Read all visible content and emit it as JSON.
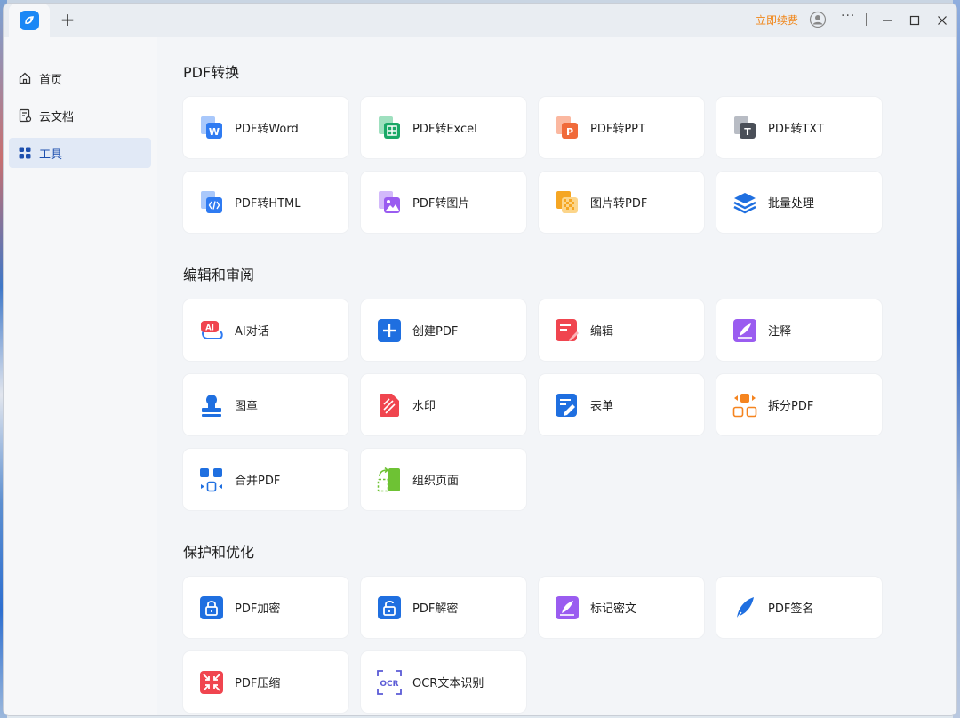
{
  "titlebar": {
    "new_tab": "+",
    "renew_label": "立即续费",
    "more": "···"
  },
  "sidebar": {
    "items": [
      {
        "label": "首页"
      },
      {
        "label": "云文档"
      },
      {
        "label": "工具"
      }
    ]
  },
  "sections": [
    {
      "title": "PDF转换",
      "tools": [
        {
          "label": "PDF转Word",
          "icon": "word-icon",
          "color": "#2f7bf2"
        },
        {
          "label": "PDF转Excel",
          "icon": "excel-icon",
          "color": "#1aa867"
        },
        {
          "label": "PDF转PPT",
          "icon": "ppt-icon",
          "color": "#f06a3a"
        },
        {
          "label": "PDF转TXT",
          "icon": "txt-icon",
          "color": "#4a4f58"
        },
        {
          "label": "PDF转HTML",
          "icon": "html-icon",
          "color": "#2f7bf2"
        },
        {
          "label": "PDF转图片",
          "icon": "image-icon",
          "color": "#9a5cf0"
        },
        {
          "label": "图片转PDF",
          "icon": "image-to-pdf-icon",
          "color": "#f5a623"
        },
        {
          "label": "批量处理",
          "icon": "layers-icon",
          "color": "#1f6fe0"
        }
      ]
    },
    {
      "title": "编辑和审阅",
      "tools": [
        {
          "label": "AI对话",
          "icon": "ai-chat-icon",
          "color": "#f0454f"
        },
        {
          "label": "创建PDF",
          "icon": "create-pdf-icon",
          "color": "#1f6fe0"
        },
        {
          "label": "编辑",
          "icon": "edit-icon",
          "color": "#f0454f"
        },
        {
          "label": "注释",
          "icon": "annotate-icon",
          "color": "#9a5cf0"
        },
        {
          "label": "图章",
          "icon": "stamp-icon",
          "color": "#1f6fe0"
        },
        {
          "label": "水印",
          "icon": "watermark-icon",
          "color": "#f0454f"
        },
        {
          "label": "表单",
          "icon": "form-icon",
          "color": "#1f6fe0"
        },
        {
          "label": "拆分PDF",
          "icon": "split-icon",
          "color": "#f5841f"
        },
        {
          "label": "合并PDF",
          "icon": "merge-icon",
          "color": "#1f6fe0"
        },
        {
          "label": "组织页面",
          "icon": "organize-icon",
          "color": "#6ec234"
        }
      ]
    },
    {
      "title": "保护和优化",
      "tools": [
        {
          "label": "PDF加密",
          "icon": "lock-icon",
          "color": "#1f6fe0"
        },
        {
          "label": "PDF解密",
          "icon": "unlock-icon",
          "color": "#1f6fe0"
        },
        {
          "label": "标记密文",
          "icon": "redact-icon",
          "color": "#9a5cf0"
        },
        {
          "label": "PDF签名",
          "icon": "signature-icon",
          "color": "#1f6fe0"
        },
        {
          "label": "PDF压缩",
          "icon": "compress-icon",
          "color": "#f0454f"
        },
        {
          "label": "OCR文本识别",
          "icon": "ocr-icon",
          "color": "#5b5bd6"
        }
      ]
    }
  ]
}
